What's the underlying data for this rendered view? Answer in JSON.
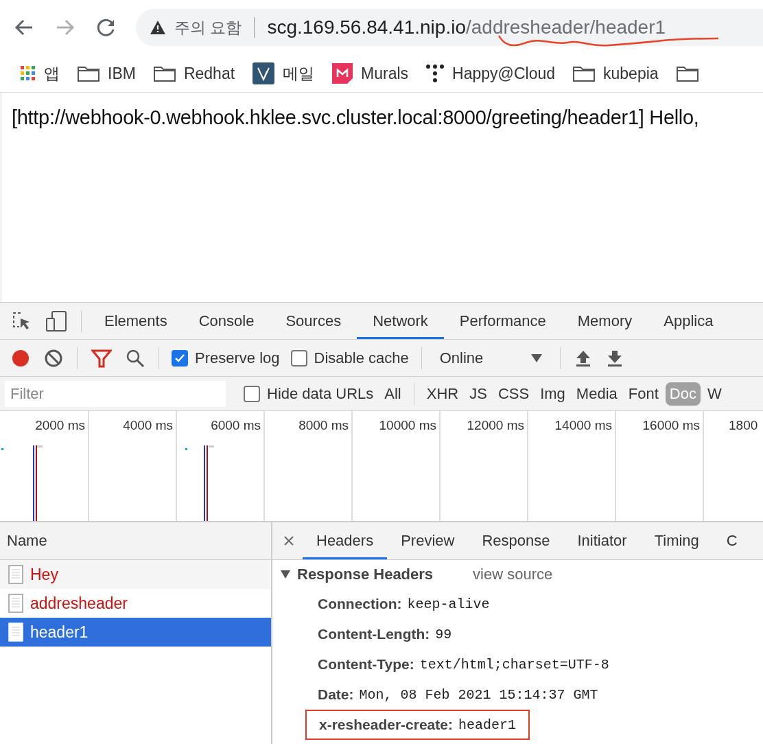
{
  "browser": {
    "security_label": "주의 요함",
    "url_host": "scg.169.56.84.41.nip.io",
    "url_path": "/addresheader/header1",
    "url_annotated": true,
    "bookmarks": [
      {
        "kind": "apps",
        "label": "앱"
      },
      {
        "kind": "folder",
        "label": "IBM"
      },
      {
        "kind": "folder",
        "label": "Redhat"
      },
      {
        "kind": "vmail",
        "label": "메일"
      },
      {
        "kind": "murals",
        "label": "Murals"
      },
      {
        "kind": "dots",
        "label": "Happy@Cloud"
      },
      {
        "kind": "folder",
        "label": "kubepia"
      },
      {
        "kind": "folder"
      }
    ]
  },
  "page": {
    "text": "[http://webhook-0.webhook.hklee.svc.cluster.local:8000/greeting/header1] Hello,"
  },
  "devtools": {
    "tabs": [
      {
        "label": "Elements",
        "selected": false
      },
      {
        "label": "Console",
        "selected": false
      },
      {
        "label": "Sources",
        "selected": false
      },
      {
        "label": "Network",
        "selected": true
      },
      {
        "label": "Performance",
        "selected": false
      },
      {
        "label": "Memory",
        "selected": false
      },
      {
        "label": "Applica",
        "selected": false
      }
    ],
    "toolbar": {
      "recording": true,
      "preserve_log": {
        "label": "Preserve log",
        "checked": true
      },
      "disable_cache": {
        "label": "Disable cache",
        "checked": false
      },
      "throttling": "Online"
    },
    "filter": {
      "placeholder": "Filter",
      "hide_data_urls": {
        "label": "Hide data URLs",
        "checked": false
      },
      "types": [
        {
          "label": "All",
          "selected": false
        },
        {
          "label": "XHR",
          "selected": false
        },
        {
          "label": "JS",
          "selected": false
        },
        {
          "label": "CSS",
          "selected": false
        },
        {
          "label": "Img",
          "selected": false
        },
        {
          "label": "Media",
          "selected": false
        },
        {
          "label": "Font",
          "selected": false
        },
        {
          "label": "Doc",
          "selected": true
        },
        {
          "label": "W",
          "selected": false
        }
      ]
    },
    "timeline_ticks": [
      "2000 ms",
      "4000 ms",
      "6000 ms",
      "8000 ms",
      "10000 ms",
      "12000 ms",
      "14000 ms",
      "16000 ms",
      "1800"
    ],
    "requests": {
      "column": "Name",
      "rows": [
        {
          "name": "Hey",
          "failed": true,
          "selected": false
        },
        {
          "name": "addresheader",
          "failed": true,
          "selected": false
        },
        {
          "name": "header1",
          "failed": false,
          "selected": true
        }
      ]
    },
    "detail_tabs": [
      {
        "label": "Headers",
        "selected": true
      },
      {
        "label": "Preview",
        "selected": false
      },
      {
        "label": "Response",
        "selected": false
      },
      {
        "label": "Initiator",
        "selected": false
      },
      {
        "label": "Timing",
        "selected": false
      },
      {
        "label": "C",
        "selected": false
      }
    ],
    "response_headers": {
      "title": "Response Headers",
      "expanded": true,
      "view_source": "view source",
      "items": [
        {
          "name": "Connection:",
          "value": "keep-alive",
          "highlighted": false
        },
        {
          "name": "Content-Length:",
          "value": "99",
          "highlighted": false
        },
        {
          "name": "Content-Type:",
          "value": "text/html;charset=UTF-8",
          "highlighted": false
        },
        {
          "name": "Date:",
          "value": "Mon, 08 Feb 2021 15:14:37 GMT",
          "highlighted": false
        },
        {
          "name": "x-resheader-create:",
          "value": "header1",
          "highlighted": true
        }
      ]
    }
  }
}
